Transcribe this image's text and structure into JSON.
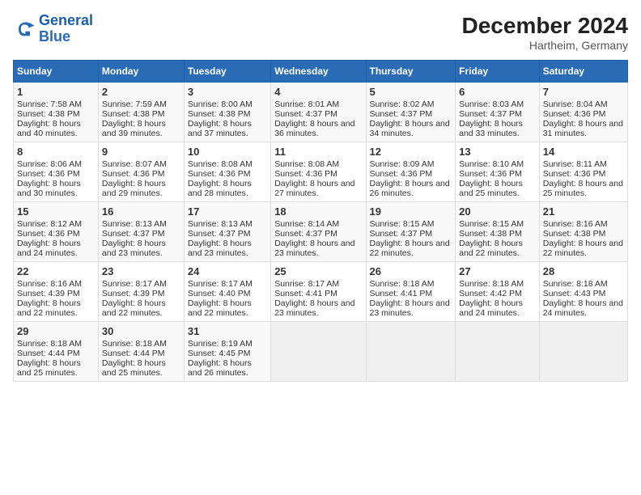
{
  "logo": {
    "line1": "General",
    "line2": "Blue"
  },
  "title": "December 2024",
  "subtitle": "Hartheim, Germany",
  "columns": [
    "Sunday",
    "Monday",
    "Tuesday",
    "Wednesday",
    "Thursday",
    "Friday",
    "Saturday"
  ],
  "weeks": [
    [
      {
        "day": "1",
        "sunrise": "Sunrise: 7:58 AM",
        "sunset": "Sunset: 4:38 PM",
        "daylight": "Daylight: 8 hours and 40 minutes."
      },
      {
        "day": "2",
        "sunrise": "Sunrise: 7:59 AM",
        "sunset": "Sunset: 4:38 PM",
        "daylight": "Daylight: 8 hours and 39 minutes."
      },
      {
        "day": "3",
        "sunrise": "Sunrise: 8:00 AM",
        "sunset": "Sunset: 4:38 PM",
        "daylight": "Daylight: 8 hours and 37 minutes."
      },
      {
        "day": "4",
        "sunrise": "Sunrise: 8:01 AM",
        "sunset": "Sunset: 4:37 PM",
        "daylight": "Daylight: 8 hours and 36 minutes."
      },
      {
        "day": "5",
        "sunrise": "Sunrise: 8:02 AM",
        "sunset": "Sunset: 4:37 PM",
        "daylight": "Daylight: 8 hours and 34 minutes."
      },
      {
        "day": "6",
        "sunrise": "Sunrise: 8:03 AM",
        "sunset": "Sunset: 4:37 PM",
        "daylight": "Daylight: 8 hours and 33 minutes."
      },
      {
        "day": "7",
        "sunrise": "Sunrise: 8:04 AM",
        "sunset": "Sunset: 4:36 PM",
        "daylight": "Daylight: 8 hours and 31 minutes."
      }
    ],
    [
      {
        "day": "8",
        "sunrise": "Sunrise: 8:06 AM",
        "sunset": "Sunset: 4:36 PM",
        "daylight": "Daylight: 8 hours and 30 minutes."
      },
      {
        "day": "9",
        "sunrise": "Sunrise: 8:07 AM",
        "sunset": "Sunset: 4:36 PM",
        "daylight": "Daylight: 8 hours and 29 minutes."
      },
      {
        "day": "10",
        "sunrise": "Sunrise: 8:08 AM",
        "sunset": "Sunset: 4:36 PM",
        "daylight": "Daylight: 8 hours and 28 minutes."
      },
      {
        "day": "11",
        "sunrise": "Sunrise: 8:08 AM",
        "sunset": "Sunset: 4:36 PM",
        "daylight": "Daylight: 8 hours and 27 minutes."
      },
      {
        "day": "12",
        "sunrise": "Sunrise: 8:09 AM",
        "sunset": "Sunset: 4:36 PM",
        "daylight": "Daylight: 8 hours and 26 minutes."
      },
      {
        "day": "13",
        "sunrise": "Sunrise: 8:10 AM",
        "sunset": "Sunset: 4:36 PM",
        "daylight": "Daylight: 8 hours and 25 minutes."
      },
      {
        "day": "14",
        "sunrise": "Sunrise: 8:11 AM",
        "sunset": "Sunset: 4:36 PM",
        "daylight": "Daylight: 8 hours and 25 minutes."
      }
    ],
    [
      {
        "day": "15",
        "sunrise": "Sunrise: 8:12 AM",
        "sunset": "Sunset: 4:36 PM",
        "daylight": "Daylight: 8 hours and 24 minutes."
      },
      {
        "day": "16",
        "sunrise": "Sunrise: 8:13 AM",
        "sunset": "Sunset: 4:37 PM",
        "daylight": "Daylight: 8 hours and 23 minutes."
      },
      {
        "day": "17",
        "sunrise": "Sunrise: 8:13 AM",
        "sunset": "Sunset: 4:37 PM",
        "daylight": "Daylight: 8 hours and 23 minutes."
      },
      {
        "day": "18",
        "sunrise": "Sunrise: 8:14 AM",
        "sunset": "Sunset: 4:37 PM",
        "daylight": "Daylight: 8 hours and 23 minutes."
      },
      {
        "day": "19",
        "sunrise": "Sunrise: 8:15 AM",
        "sunset": "Sunset: 4:37 PM",
        "daylight": "Daylight: 8 hours and 22 minutes."
      },
      {
        "day": "20",
        "sunrise": "Sunrise: 8:15 AM",
        "sunset": "Sunset: 4:38 PM",
        "daylight": "Daylight: 8 hours and 22 minutes."
      },
      {
        "day": "21",
        "sunrise": "Sunrise: 8:16 AM",
        "sunset": "Sunset: 4:38 PM",
        "daylight": "Daylight: 8 hours and 22 minutes."
      }
    ],
    [
      {
        "day": "22",
        "sunrise": "Sunrise: 8:16 AM",
        "sunset": "Sunset: 4:39 PM",
        "daylight": "Daylight: 8 hours and 22 minutes."
      },
      {
        "day": "23",
        "sunrise": "Sunrise: 8:17 AM",
        "sunset": "Sunset: 4:39 PM",
        "daylight": "Daylight: 8 hours and 22 minutes."
      },
      {
        "day": "24",
        "sunrise": "Sunrise: 8:17 AM",
        "sunset": "Sunset: 4:40 PM",
        "daylight": "Daylight: 8 hours and 22 minutes."
      },
      {
        "day": "25",
        "sunrise": "Sunrise: 8:17 AM",
        "sunset": "Sunset: 4:41 PM",
        "daylight": "Daylight: 8 hours and 23 minutes."
      },
      {
        "day": "26",
        "sunrise": "Sunrise: 8:18 AM",
        "sunset": "Sunset: 4:41 PM",
        "daylight": "Daylight: 8 hours and 23 minutes."
      },
      {
        "day": "27",
        "sunrise": "Sunrise: 8:18 AM",
        "sunset": "Sunset: 4:42 PM",
        "daylight": "Daylight: 8 hours and 24 minutes."
      },
      {
        "day": "28",
        "sunrise": "Sunrise: 8:18 AM",
        "sunset": "Sunset: 4:43 PM",
        "daylight": "Daylight: 8 hours and 24 minutes."
      }
    ],
    [
      {
        "day": "29",
        "sunrise": "Sunrise: 8:18 AM",
        "sunset": "Sunset: 4:44 PM",
        "daylight": "Daylight: 8 hours and 25 minutes."
      },
      {
        "day": "30",
        "sunrise": "Sunrise: 8:18 AM",
        "sunset": "Sunset: 4:44 PM",
        "daylight": "Daylight: 8 hours and 25 minutes."
      },
      {
        "day": "31",
        "sunrise": "Sunrise: 8:19 AM",
        "sunset": "Sunset: 4:45 PM",
        "daylight": "Daylight: 8 hours and 26 minutes."
      },
      null,
      null,
      null,
      null
    ]
  ]
}
